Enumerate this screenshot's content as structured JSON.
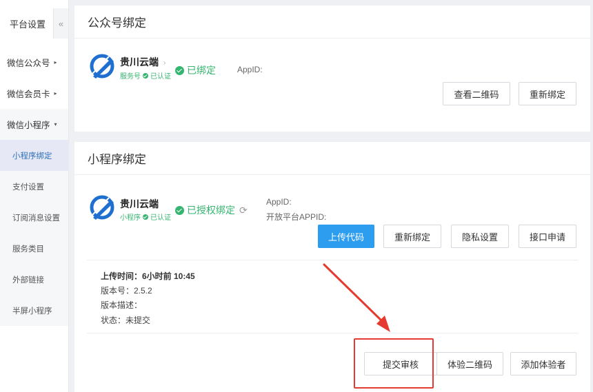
{
  "sidebar": {
    "title": "平台设置",
    "collapse_icon": "«",
    "groups": [
      {
        "label": "微信公众号"
      },
      {
        "label": "微信会员卡"
      },
      {
        "label": "微信小程序"
      }
    ],
    "sub_items": [
      {
        "label": "小程序绑定"
      },
      {
        "label": "支付设置"
      },
      {
        "label": "订阅消息设置"
      },
      {
        "label": "服务类目"
      },
      {
        "label": "外部链接"
      },
      {
        "label": "半屏小程序"
      }
    ]
  },
  "official_account": {
    "section_title": "公众号绑定",
    "name": "贵川云端",
    "type_label": "服务号",
    "verified_label": "已认证",
    "status": "已绑定",
    "appid_label": "AppID:",
    "buttons": {
      "qrcode": "查看二维码",
      "rebind": "重新绑定"
    }
  },
  "mini_program": {
    "section_title": "小程序绑定",
    "name": "贵川云端",
    "type_label": "小程序",
    "verified_label": "已认证",
    "status": "已授权绑定",
    "appid_label": "AppID:",
    "open_appid_label": "开放平台APPID:",
    "buttons": {
      "upload": "上传代码",
      "rebind": "重新绑定",
      "privacy": "隐私设置",
      "api": "接口申请"
    },
    "version": {
      "upload_time": "上传时间：6小时前 10:45",
      "version_no": "版本号：2.5.2",
      "description": "版本描述：",
      "status": "状态：未提交"
    },
    "actions": {
      "submit_review": "提交审核",
      "trial_qrcode": "体验二维码",
      "add_tester": "添加体验者"
    }
  },
  "colors": {
    "accent": "#2d9df0",
    "success": "#35b56f",
    "annotation": "#e53a2f"
  }
}
